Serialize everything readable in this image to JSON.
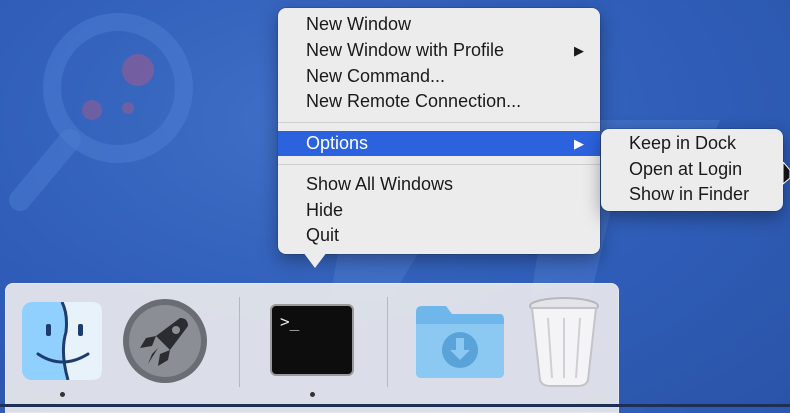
{
  "context_menu": {
    "items": [
      {
        "label": "New Window"
      },
      {
        "label": "New Window with Profile",
        "has_submenu": true
      },
      {
        "label": "New Command..."
      },
      {
        "label": "New Remote Connection..."
      },
      {
        "label": "Options",
        "has_submenu": true,
        "highlighted": true
      },
      {
        "label": "Show All Windows"
      },
      {
        "label": "Hide"
      },
      {
        "label": "Quit"
      }
    ],
    "submenu_arrow": "▶"
  },
  "options_submenu": {
    "items": [
      {
        "label": "Keep in Dock"
      },
      {
        "label": "Open at Login"
      },
      {
        "label": "Show in Finder"
      }
    ]
  },
  "dock": {
    "apps": [
      {
        "icon": "finder-icon",
        "running": true
      },
      {
        "icon": "launchpad-rocket-icon",
        "running": false
      },
      {
        "icon": "terminal-icon",
        "running": true,
        "prompt": ">_"
      },
      {
        "icon": "downloads-folder-icon",
        "running": false
      },
      {
        "icon": "trash-icon",
        "running": false
      }
    ]
  },
  "colors": {
    "desktop": "#2f5db8",
    "menu_bg": "#ececec",
    "highlight": "#2c62dd"
  }
}
